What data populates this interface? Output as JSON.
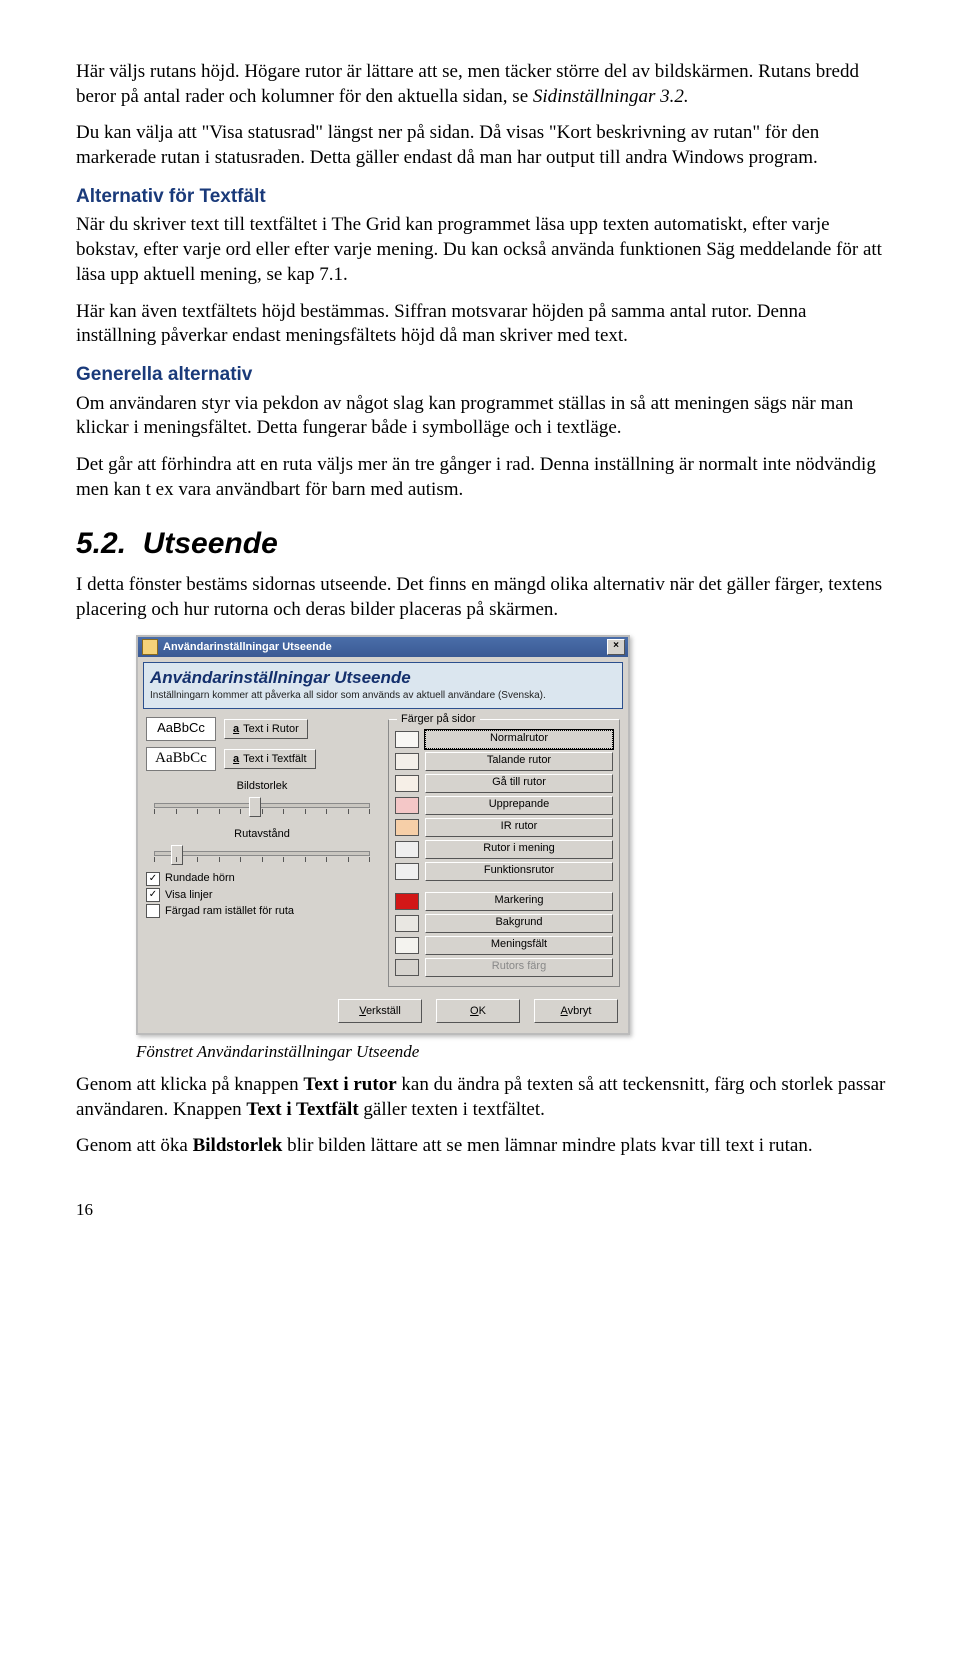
{
  "para1": "Här väljs rutans höjd. Högare rutor är lättare att se, men täcker större del av bildskärmen. Rutans bredd beror på antal rader och kolumner för den aktuella sidan, se ",
  "para1_em": "Sidinställningar 3.2.",
  "para2": "Du kan välja att \"Visa statusrad\" längst ner på sidan. Då visas \"Kort beskrivning av rutan\" för den markerade rutan i statusraden. Detta gäller endast då man har output till andra Windows program.",
  "sub1": "Alternativ för Textfält",
  "para3": "När du skriver text till textfältet i The Grid kan programmet läsa upp texten automatiskt, efter varje bokstav, efter varje ord eller efter varje mening. Du kan också använda funktionen Säg meddelande för att läsa upp aktuell mening, se kap 7.1.",
  "para4": "Här kan även textfältets höjd bestämmas. Siffran motsvarar höjden på samma antal rutor. Denna inställning påverkar endast meningsfältets höjd då man skriver med text.",
  "sub2": "Generella alternativ",
  "para5": "Om användaren styr via pekdon av något slag kan programmet ställas in så att meningen sägs när man klickar i meningsfältet. Detta fungerar både i symbolläge och i textläge.",
  "para6": "Det går att förhindra att en ruta väljs mer än tre gånger i rad. Denna inställning är normalt inte nödvändig men kan t ex vara användbart för barn med autism.",
  "sec_num": "5.2.",
  "sec_title": "Utseende",
  "para7": "I detta fönster bestäms sidornas utseende. Det finns en mängd olika alternativ när det gäller färger, textens placering och hur rutorna och deras bilder placeras på skärmen.",
  "dlg": {
    "title": "Användarinställningar Utseende",
    "hdr_big": "Användarinställningar Utseende",
    "hdr_small": "Inställningarn kommer att påverka all sidor som används av aktuell användare (Svenska).",
    "sample": "AaBbCc",
    "btn_rutor": "Text i Rutor",
    "btn_textfalt": "Text i Textfält",
    "slider1": "Bildstorlek",
    "slider2": "Rutavstånd",
    "chk1": "Rundade hörn",
    "chk2": "Visa linjer",
    "chk3": "Färgad ram istället för ruta",
    "group": "Färger på sidor",
    "colors": [
      {
        "hex": "#f8f7f4",
        "label": "Normalrutor",
        "focus": true
      },
      {
        "hex": "#f3efe9",
        "label": "Talande rutor"
      },
      {
        "hex": "#f6efe7",
        "label": "Gå till rutor"
      },
      {
        "hex": "#f4c7c7",
        "label": "Upprepande"
      },
      {
        "hex": "#f6cfa8",
        "label": "IR rutor"
      },
      {
        "hex": "#efefef",
        "label": "Rutor i mening"
      },
      {
        "hex": "#efefef",
        "label": "Funktionsrutor"
      }
    ],
    "colors2": [
      {
        "hex": "#d21717",
        "label": "Markering"
      },
      {
        "hex": "#e9e7e2",
        "label": "Bakgrund"
      },
      {
        "hex": "#f4f3ef",
        "label": "Meningsfält"
      },
      {
        "hex": "#d6d3ce",
        "label": "Rutors färg",
        "disabled": true
      }
    ],
    "verkstall": "Verkställ",
    "ok": "OK",
    "avbryt": "Avbryt"
  },
  "caption": "Fönstret Användarinställningar Utseende",
  "para8a": "Genom att klicka på knappen ",
  "para8b": "Text i rutor",
  "para8c": " kan du ändra på texten så att teckensnitt, färg och storlek passar användaren. Knappen ",
  "para8d": "Text i Textfält",
  "para8e": " gäller texten i textfältet.",
  "para9a": "Genom att öka ",
  "para9b": "Bildstorlek",
  "para9c": " blir bilden lättare att se men lämnar mindre plats kvar till text i rutan.",
  "pagenum": "16"
}
